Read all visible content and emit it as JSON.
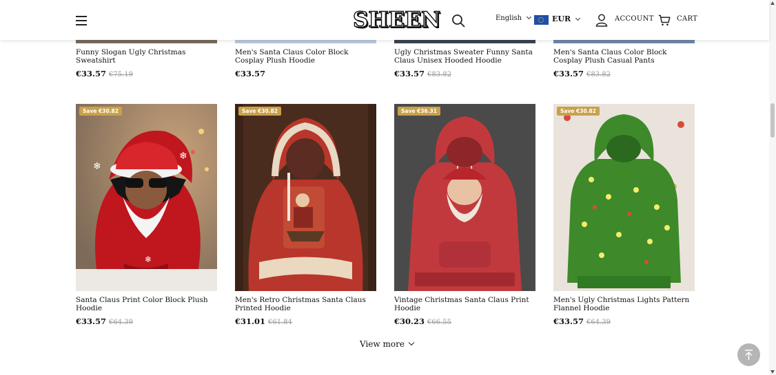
{
  "header": {
    "logo_text": "SHEEN",
    "language": "English",
    "currency": "EUR",
    "account_label": "ACCOUNT",
    "cart_label": "CART",
    "icons": [
      "menu-icon",
      "search-icon",
      "eu-flag-icon",
      "account-icon",
      "cart-icon"
    ]
  },
  "top_row": [
    {
      "name": "Funny Slogan Ugly Christmas Sweatshirt",
      "price": "€33.57",
      "old_price": "€75.19"
    },
    {
      "name": "Men's Santa Claus Color Block Cosplay Plush Hoodie",
      "price": "€33.57",
      "old_price": ""
    },
    {
      "name": "Ugly Christmas Sweater Funny Santa Claus Unisex Hooded Hoodie",
      "price": "€33.57",
      "old_price": "€83.82"
    },
    {
      "name": "Men's Santa Claus Color Block Cosplay Plush Casual Pants",
      "price": "€33.57",
      "old_price": "€83.82"
    }
  ],
  "products": [
    {
      "badge": "Save €30.82",
      "name": "Santa Claus Print Color Block Plush Hoodie",
      "price": "€33.57",
      "old_price": "€64.39"
    },
    {
      "badge": "Save €30.82",
      "name": "Men's Retro Christmas Santa Claus Printed Hoodie",
      "price": "€31.01",
      "old_price": "€61.84"
    },
    {
      "badge": "Save €36.31",
      "name": "Vintage Christmas Santa Claus Print Hoodie",
      "price": "€30.23",
      "old_price": "€66.55"
    },
    {
      "badge": "Save €30.82",
      "name": "Men's Ugly Christmas Lights Pattern Flannel Hoodie",
      "price": "€33.57",
      "old_price": "€64.39"
    }
  ],
  "view_more": "View more",
  "colors": {
    "badge": "#c9a14a",
    "back_to_top": "#b5b5b5"
  }
}
